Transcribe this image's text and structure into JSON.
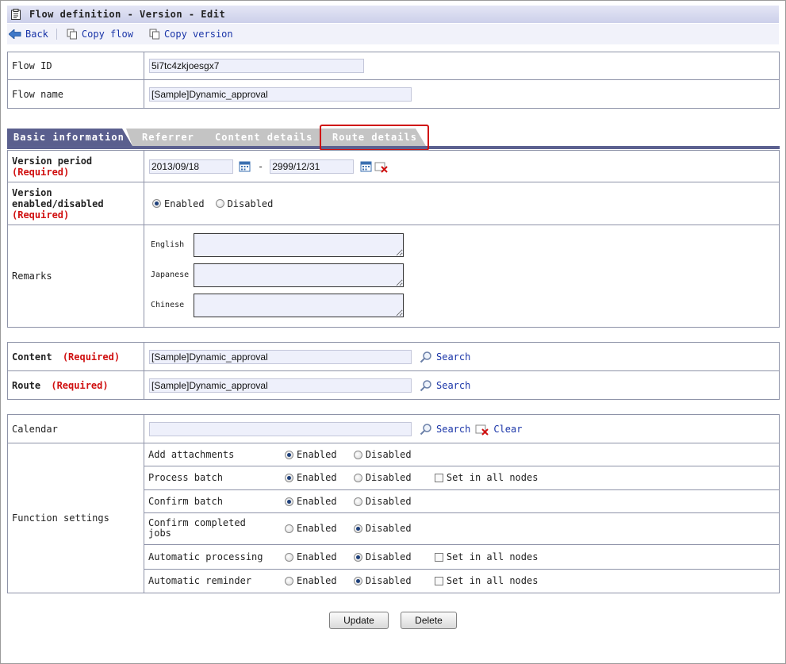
{
  "title": "Flow definition - Version - Edit",
  "toolbar": {
    "back": "Back",
    "copy_flow": "Copy flow",
    "copy_version": "Copy version"
  },
  "flow": {
    "id_label": "Flow ID",
    "id_value": "5i7tc4zkjoesgx7",
    "name_label": "Flow name",
    "name_value": "[Sample]Dynamic_approval"
  },
  "tabs": [
    {
      "label": "Basic information"
    },
    {
      "label": "Referrer"
    },
    {
      "label": "Content details"
    },
    {
      "label": "Route details"
    }
  ],
  "version_period": {
    "label": "Version period",
    "required": "(Required)",
    "start": "2013/09/18",
    "separator": "-",
    "end": "2999/12/31"
  },
  "version_enabled": {
    "label": "Version enabled/disabled",
    "required": "(Required)",
    "enabled": "Enabled",
    "disabled": "Disabled"
  },
  "remarks": {
    "label": "Remarks",
    "english": "English",
    "japanese": "Japanese",
    "chinese": "Chinese"
  },
  "content": {
    "label": "Content",
    "required": "(Required)",
    "value": "[Sample]Dynamic_approval",
    "search": "Search"
  },
  "route": {
    "label": "Route",
    "required": "(Required)",
    "value": "[Sample]Dynamic_approval",
    "search": "Search"
  },
  "calendar": {
    "label": "Calendar",
    "value": "",
    "search": "Search",
    "clear": "Clear"
  },
  "functions": {
    "label": "Function settings",
    "enabled": "Enabled",
    "disabled": "Disabled",
    "set_all": "Set in all nodes",
    "items": [
      {
        "name": "Add attachments",
        "state": "enabled"
      },
      {
        "name": "Process batch",
        "state": "enabled"
      },
      {
        "name": "Confirm batch",
        "state": "enabled"
      },
      {
        "name": "Confirm completed jobs",
        "state": "disabled"
      },
      {
        "name": "Automatic processing",
        "state": "disabled"
      },
      {
        "name": "Automatic reminder",
        "state": "disabled"
      }
    ]
  },
  "buttons": {
    "update": "Update",
    "delete": "Delete"
  }
}
